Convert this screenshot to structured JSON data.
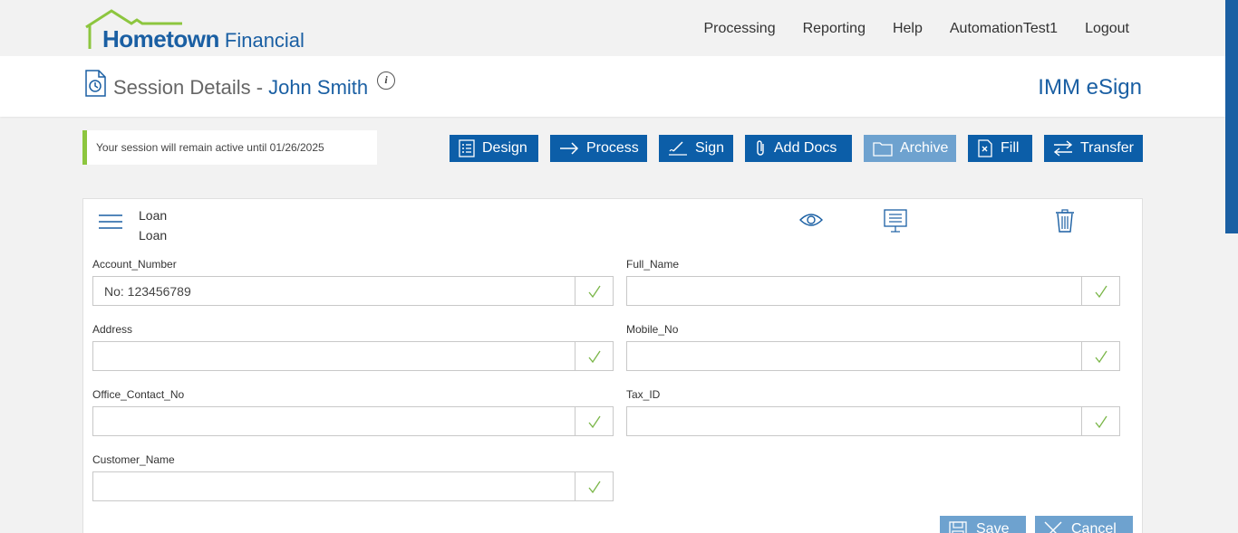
{
  "logo": {
    "main": "Hometown",
    "sub": "Financial"
  },
  "nav": [
    {
      "label": "Processing"
    },
    {
      "label": "Reporting"
    },
    {
      "label": "Help"
    },
    {
      "label": "AutomationTest1"
    },
    {
      "label": "Logout"
    }
  ],
  "session": {
    "title_prefix": "Session Details -",
    "customer_name": "John Smith",
    "info_glyph": "i",
    "brand": "IMM eSign",
    "notice": "Your session will remain active until 01/26/2025"
  },
  "actions": {
    "design": "Design",
    "process": "Process",
    "sign": "Sign",
    "add_docs": "Add Docs",
    "archive": "Archive",
    "fill": "Fill",
    "transfer": "Transfer"
  },
  "document": {
    "title": "Loan",
    "subtitle": "Loan"
  },
  "fields": {
    "account_number": {
      "label": "Account_Number",
      "value": "No: 123456789"
    },
    "full_name": {
      "label": "Full_Name",
      "value": ""
    },
    "address": {
      "label": "Address",
      "value": ""
    },
    "mobile_no": {
      "label": "Mobile_No",
      "value": ""
    },
    "office_contact_no": {
      "label": "Office_Contact_No",
      "value": ""
    },
    "tax_id": {
      "label": "Tax_ID",
      "value": ""
    },
    "customer_name": {
      "label": "Customer_Name",
      "value": ""
    }
  },
  "footer": {
    "save": "Save",
    "cancel": "Cancel"
  },
  "colors": {
    "primary": "#0c5ea8",
    "primary_disabled": "#6ea2cf",
    "accent_green": "#8dc63f",
    "check_green": "#7ab648"
  }
}
